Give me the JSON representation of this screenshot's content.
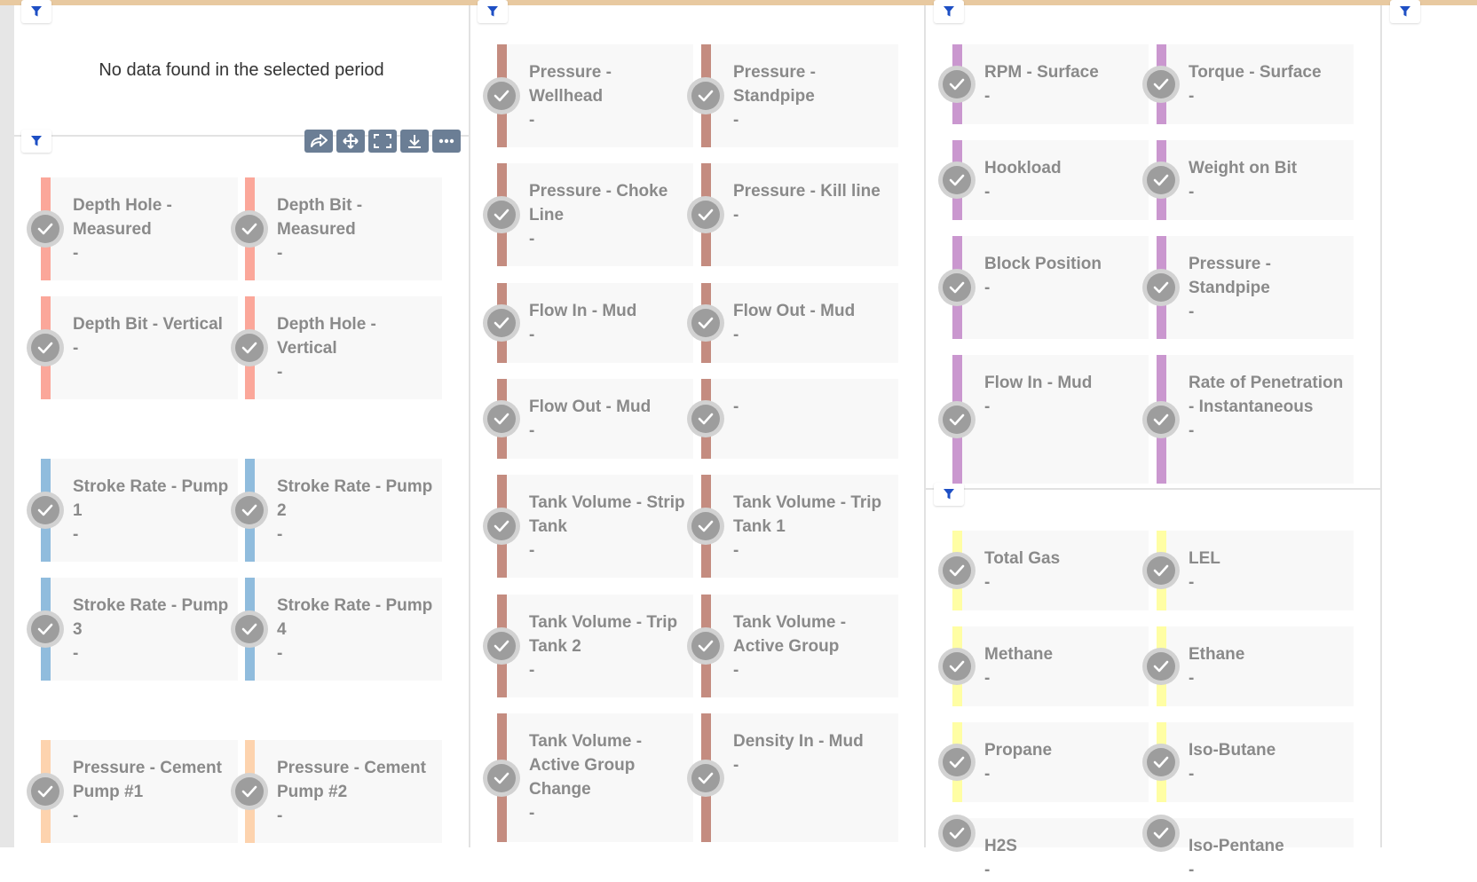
{
  "empty_message": "No data found in the selected period",
  "colors": {
    "depth": "#fba79a",
    "stroke": "#90bcdd",
    "cement": "#fdd3ae",
    "pressure": "#c48c80",
    "drilling": "#ca97cf",
    "gas": "#fffea4"
  },
  "toolbar_icons": [
    "share-icon",
    "move-icon",
    "fullscreen-icon",
    "download-icon",
    "more-icon"
  ],
  "panel1": {
    "tiles": [
      {
        "label": "Depth Hole - Measured",
        "value": "-"
      },
      {
        "label": "Depth Bit - Measured",
        "value": "-"
      },
      {
        "label": "Depth Bit - Vertical",
        "value": "-"
      },
      {
        "label": "Depth Hole - Vertical",
        "value": "-"
      },
      {
        "label": "Stroke Rate - Pump 1",
        "value": "-"
      },
      {
        "label": "Stroke Rate - Pump 2",
        "value": "-"
      },
      {
        "label": "Stroke Rate - Pump 3",
        "value": "-"
      },
      {
        "label": "Stroke Rate - Pump 4",
        "value": "-"
      },
      {
        "label": "Pressure - Cement Pump #1",
        "value": "-"
      },
      {
        "label": "Pressure - Cement Pump #2",
        "value": "-"
      }
    ]
  },
  "panel2": {
    "tiles": [
      {
        "label": "Pressure - Wellhead",
        "value": "-"
      },
      {
        "label": "Pressure - Standpipe",
        "value": "-"
      },
      {
        "label": "Pressure - Choke Line",
        "value": "-"
      },
      {
        "label": "Pressure - Kill line",
        "value": "-"
      },
      {
        "label": "Flow In - Mud",
        "value": "-"
      },
      {
        "label": "Flow Out - Mud",
        "value": "-"
      },
      {
        "label": "Flow Out - Mud",
        "value": "-"
      },
      {
        "label": "",
        "value": "-"
      },
      {
        "label": "Tank Volume - Strip Tank",
        "value": "-"
      },
      {
        "label": "Tank Volume - Trip Tank 1",
        "value": "-"
      },
      {
        "label": "Tank Volume - Trip Tank 2",
        "value": "-"
      },
      {
        "label": "Tank Volume - Active Group",
        "value": "-"
      },
      {
        "label": "Tank Volume - Active Group Change",
        "value": "-"
      },
      {
        "label": "Density In - Mud",
        "value": "-"
      }
    ]
  },
  "panel3": {
    "tiles": [
      {
        "label": "RPM - Surface",
        "value": "-"
      },
      {
        "label": "Torque - Surface",
        "value": "-"
      },
      {
        "label": "Hookload",
        "value": "-"
      },
      {
        "label": "Weight on Bit",
        "value": "-"
      },
      {
        "label": "Block Position",
        "value": "-"
      },
      {
        "label": "Pressure - Standpipe",
        "value": "-"
      },
      {
        "label": "Flow In - Mud",
        "value": "-"
      },
      {
        "label": "Rate of Penetration - Instantaneous",
        "value": "-"
      }
    ]
  },
  "panel4": {
    "tiles": [
      {
        "label": "Total Gas",
        "value": "-"
      },
      {
        "label": "LEL",
        "value": "-"
      },
      {
        "label": "Methane",
        "value": "-"
      },
      {
        "label": "Ethane",
        "value": "-"
      },
      {
        "label": "Propane",
        "value": "-"
      },
      {
        "label": "Iso-Butane",
        "value": "-"
      },
      {
        "label": "H2S",
        "value": "-"
      },
      {
        "label": "Iso-Pentane",
        "value": "-"
      }
    ]
  }
}
